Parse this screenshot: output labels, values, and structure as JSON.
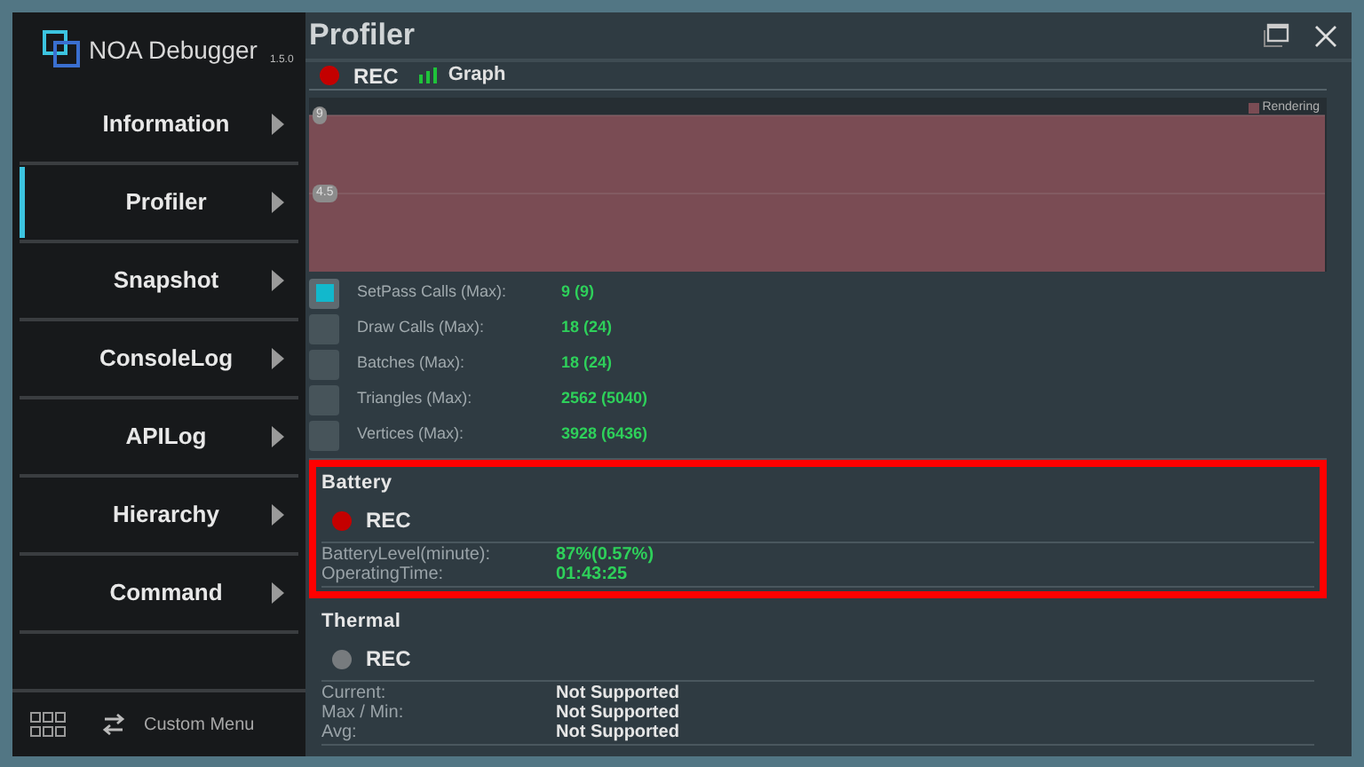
{
  "app": {
    "name": "NOA Debugger",
    "version": "1.5.0"
  },
  "sidebar": {
    "items": [
      {
        "label": "Information",
        "selected": false
      },
      {
        "label": "Profiler",
        "selected": true
      },
      {
        "label": "Snapshot",
        "selected": false
      },
      {
        "label": "ConsoleLog",
        "selected": false
      },
      {
        "label": "APILog",
        "selected": false
      },
      {
        "label": "Hierarchy",
        "selected": false
      },
      {
        "label": "Command",
        "selected": false
      }
    ],
    "footer": {
      "custom_menu": "Custom Menu"
    }
  },
  "window": {
    "title": "Profiler"
  },
  "rendering": {
    "rec": {
      "label": "REC",
      "on": true
    },
    "graph": "Graph",
    "graph_panel": {
      "axis_labels": [
        "9",
        "4.5"
      ],
      "legend": "Rendering"
    },
    "metrics": [
      {
        "label": "SetPass Calls (Max):",
        "value": "9 (9)",
        "selected": true
      },
      {
        "label": "Draw Calls (Max):",
        "value": "18 (24)",
        "selected": false
      },
      {
        "label": "Batches (Max):",
        "value": "18 (24)",
        "selected": false
      },
      {
        "label": "Triangles (Max):",
        "value": "2562 (5040)",
        "selected": false
      },
      {
        "label": "Vertices (Max):",
        "value": "3928 (6436)",
        "selected": false
      }
    ]
  },
  "battery": {
    "title": "Battery",
    "highlighted": true,
    "rec": {
      "label": "REC",
      "on": true
    },
    "rows": [
      {
        "label": "BatteryLevel(minute):",
        "value": "87%(0.57%)"
      },
      {
        "label": "OperatingTime:",
        "value": "01:43:25"
      }
    ]
  },
  "thermal": {
    "title": "Thermal",
    "highlighted": false,
    "rec": {
      "label": "REC",
      "on": false
    },
    "rows": [
      {
        "label": "Current:",
        "value": "Not Supported"
      },
      {
        "label": "Max / Min:",
        "value": "Not Supported"
      },
      {
        "label": "Avg:",
        "value": "Not Supported"
      }
    ]
  }
}
